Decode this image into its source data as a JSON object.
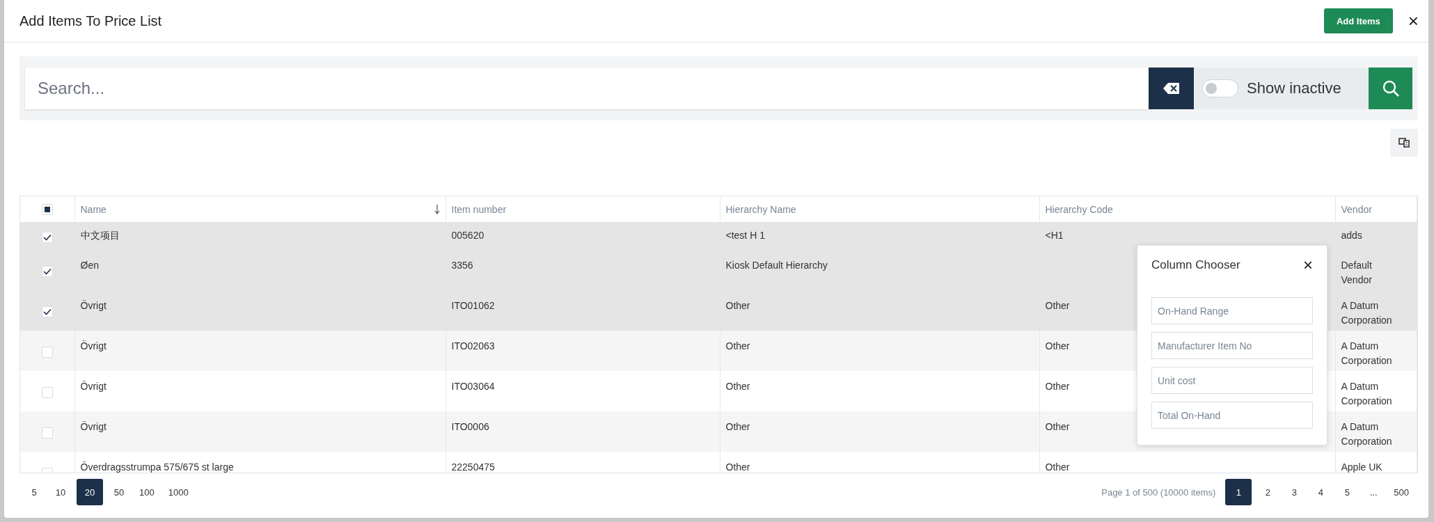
{
  "dialog": {
    "title": "Add Items To Price List",
    "primary_button": "Add Items",
    "close": "×"
  },
  "search": {
    "placeholder": "Search...",
    "show_inactive": {
      "label": "Show inactive",
      "on": false
    }
  },
  "table": {
    "select_all": {
      "indeterminate": true
    },
    "columns": [
      {
        "label": "Name",
        "sorted": true
      },
      {
        "label": "Item number",
        "sorted": false
      },
      {
        "label": "Hierarchy Name",
        "sorted": false
      },
      {
        "label": "Hierarchy Code",
        "sorted": false
      },
      {
        "label": "Vendor",
        "sorted": false
      }
    ],
    "rows": [
      {
        "selected": true,
        "cells": [
          "中文项目",
          "005620",
          "<test H 1",
          "<H1",
          "adds"
        ]
      },
      {
        "selected": true,
        "cells": [
          "Øen",
          "3356",
          "Kiosk Default Hierarchy",
          "",
          "Default Vendor"
        ]
      },
      {
        "selected": true,
        "cells": [
          "Övrigt",
          "ITO01062",
          "Other",
          "Other",
          "A Datum Corporation"
        ]
      },
      {
        "selected": false,
        "cells": [
          "Övrigt",
          "ITO02063",
          "Other",
          "Other",
          "A Datum Corporation"
        ]
      },
      {
        "selected": false,
        "cells": [
          "Övrigt",
          "ITO03064",
          "Other",
          "Other",
          "A Datum Corporation"
        ]
      },
      {
        "selected": false,
        "cells": [
          "Övrigt",
          "ITO0006",
          "Other",
          "Other",
          "A Datum Corporation"
        ]
      },
      {
        "selected": false,
        "cells": [
          "Överdragsstrumpa 575/675 st large",
          "22250475",
          "Other",
          "Other",
          "Apple UK"
        ]
      }
    ]
  },
  "column_chooser": {
    "title": "Column Chooser",
    "close": "×",
    "columns": [
      "On-Hand Range",
      "Manufacturer Item No",
      "Unit cost",
      "Total On-Hand"
    ]
  },
  "pagination": {
    "page_sizes": [
      {
        "label": "5",
        "selected": false
      },
      {
        "label": "10",
        "selected": false
      },
      {
        "label": "20",
        "selected": true
      },
      {
        "label": "50",
        "selected": false
      },
      {
        "label": "100",
        "selected": false
      },
      {
        "label": "1000",
        "selected": false
      }
    ],
    "info": "Page 1 of 500 (10000 items)",
    "pages": [
      {
        "label": "1",
        "selected": true
      },
      {
        "label": "2",
        "selected": false
      },
      {
        "label": "3",
        "selected": false
      },
      {
        "label": "4",
        "selected": false
      },
      {
        "label": "5",
        "selected": false
      },
      {
        "label": "...",
        "selected": false
      },
      {
        "label": "500",
        "selected": false
      }
    ]
  }
}
